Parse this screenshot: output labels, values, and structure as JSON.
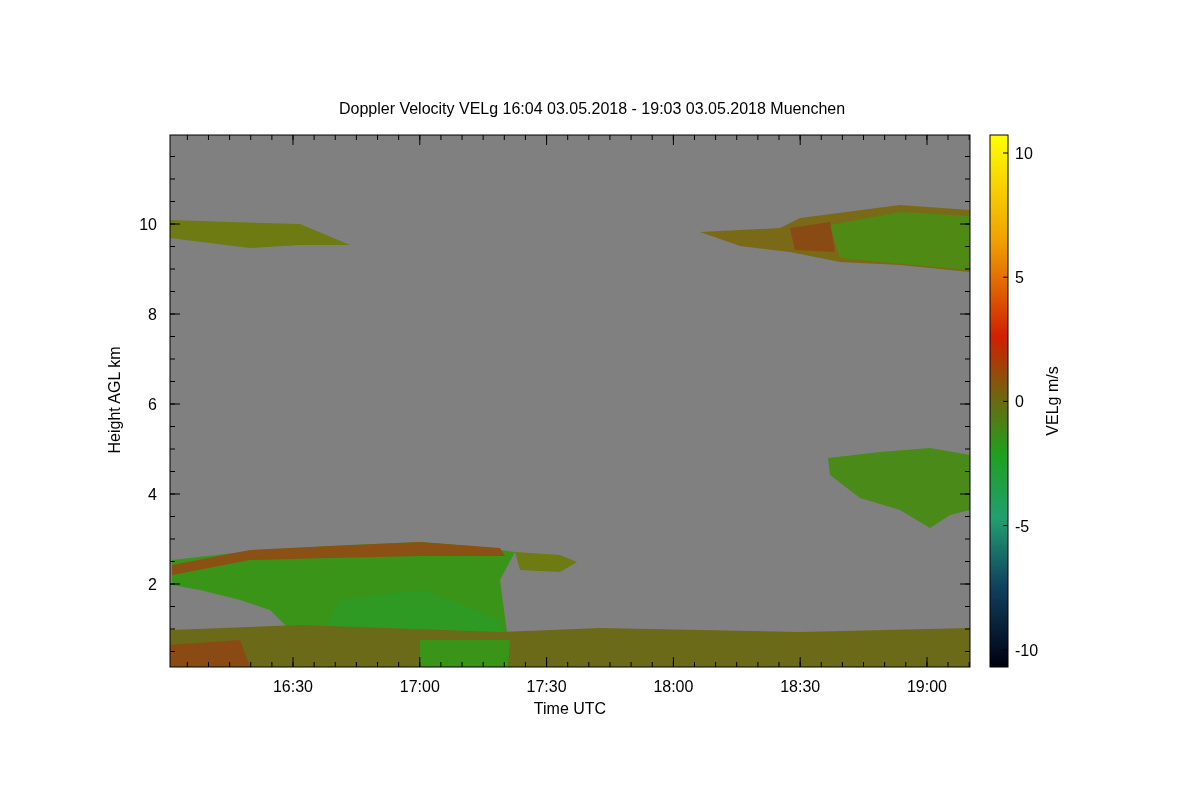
{
  "plot": {
    "title": "Doppler Velocity VELg   16:04 03.05.2018 - 19:03 03.05.2018 Muenchen",
    "x_axis": {
      "label": "Time UTC",
      "ticks": [
        "16:30",
        "17:00",
        "17:30",
        "18:00",
        "18:30",
        "19:00"
      ]
    },
    "y_axis": {
      "label": "Height AGL km",
      "ticks": [
        "10",
        "8",
        "6",
        "4",
        "2"
      ]
    },
    "colorbar": {
      "label": "VELg m/s",
      "ticks": [
        "10",
        "5",
        "0",
        "-5",
        "-10"
      ]
    }
  }
}
